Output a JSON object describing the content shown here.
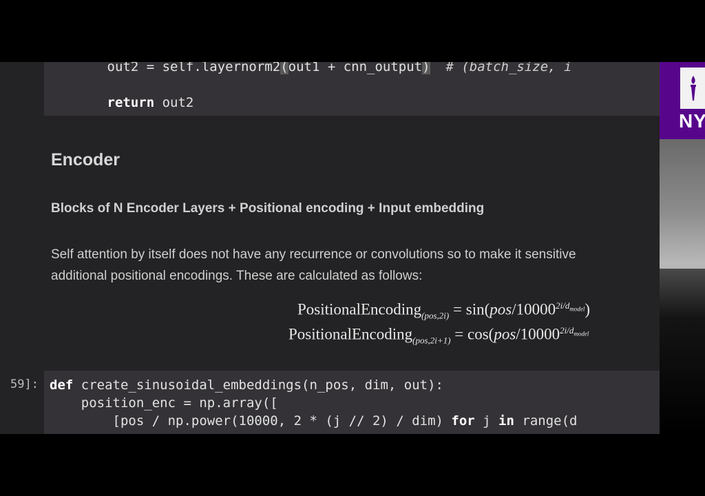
{
  "top_cell": {
    "line1": {
      "indent": "        ",
      "before_bracket": "out2 = self.layernorm2",
      "open": "(",
      "middle": "out1 + cnn_output",
      "close": ")",
      "comment": "  # (batch_size, i"
    },
    "line2": {
      "indent": "        ",
      "keyword": "return",
      "rest": " out2"
    }
  },
  "markdown": {
    "heading": "Encoder",
    "subheading": "Blocks of N Encoder Layers + Positional encoding + Input embedding",
    "paragraph_line1": "Self attention by itself does not have any recurrence or convolutions so to make it sensitive",
    "paragraph_line2": "additional positional encodings. These are calculated as follows:"
  },
  "formulas": {
    "f1": {
      "name": "PositionalEncoding",
      "sub": "(pos,2i)",
      "eq": " = sin(",
      "pos": "pos",
      "div": "/10000",
      "sup": "2i/d",
      "sup_sub": "model",
      "tail": ")"
    },
    "f2": {
      "name": "PositionalEncoding",
      "sub": "(pos,2i+1)",
      "eq": " = cos(",
      "pos": "pos",
      "div": "/10000",
      "sup": "2i/d",
      "sup_sub": "model",
      "tail": ""
    }
  },
  "bottom_cell": {
    "prompt": "59]:",
    "line1": {
      "keyword": "def",
      "rest": " create_sinusoidal_embeddings(n_pos, dim, out):"
    },
    "line2": {
      "text": "    position_enc = np.array(["
    },
    "line3": {
      "before": "        [pos / np.power(10000, 2 * (j // 2) / dim) ",
      "kw_for": "for",
      "mid": " j ",
      "kw_in": "in",
      "after": " range(d"
    }
  },
  "video": {
    "logo_text": "NY"
  }
}
